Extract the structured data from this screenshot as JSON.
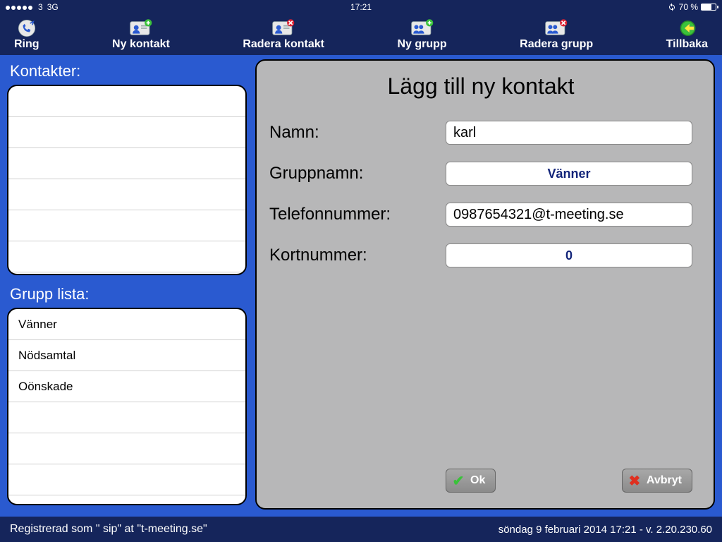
{
  "statusbar": {
    "carrier": "3",
    "network": "3G",
    "time": "17:21",
    "battery_pct": "70 %"
  },
  "toolbar": {
    "ring": "Ring",
    "ny_kontakt": "Ny kontakt",
    "radera_kontakt": "Radera kontakt",
    "ny_grupp": "Ny grupp",
    "radera_grupp": "Radera grupp",
    "tillbaka": "Tillbaka"
  },
  "left": {
    "kontakter_title": "Kontakter:",
    "grupp_title": "Grupp lista:",
    "groups": [
      "Vänner",
      "Nödsamtal",
      "Oönskade"
    ]
  },
  "panel": {
    "title": "Lägg till ny kontakt",
    "labels": {
      "namn": "Namn:",
      "gruppnamn": "Gruppnamn:",
      "telefonnummer": "Telefonnummer:",
      "kortnummer": "Kortnummer:"
    },
    "values": {
      "namn": "karl",
      "gruppnamn": "Vänner",
      "telefonnummer": "0987654321@t-meeting.se",
      "kortnummer": "0"
    },
    "buttons": {
      "ok": "Ok",
      "avbryt": "Avbryt"
    }
  },
  "footer": {
    "left": "Registrerad som \" sip\" at \"t-meeting.se\"",
    "right": "söndag 9 februari 2014 17:21 - v. 2.20.230.60"
  }
}
